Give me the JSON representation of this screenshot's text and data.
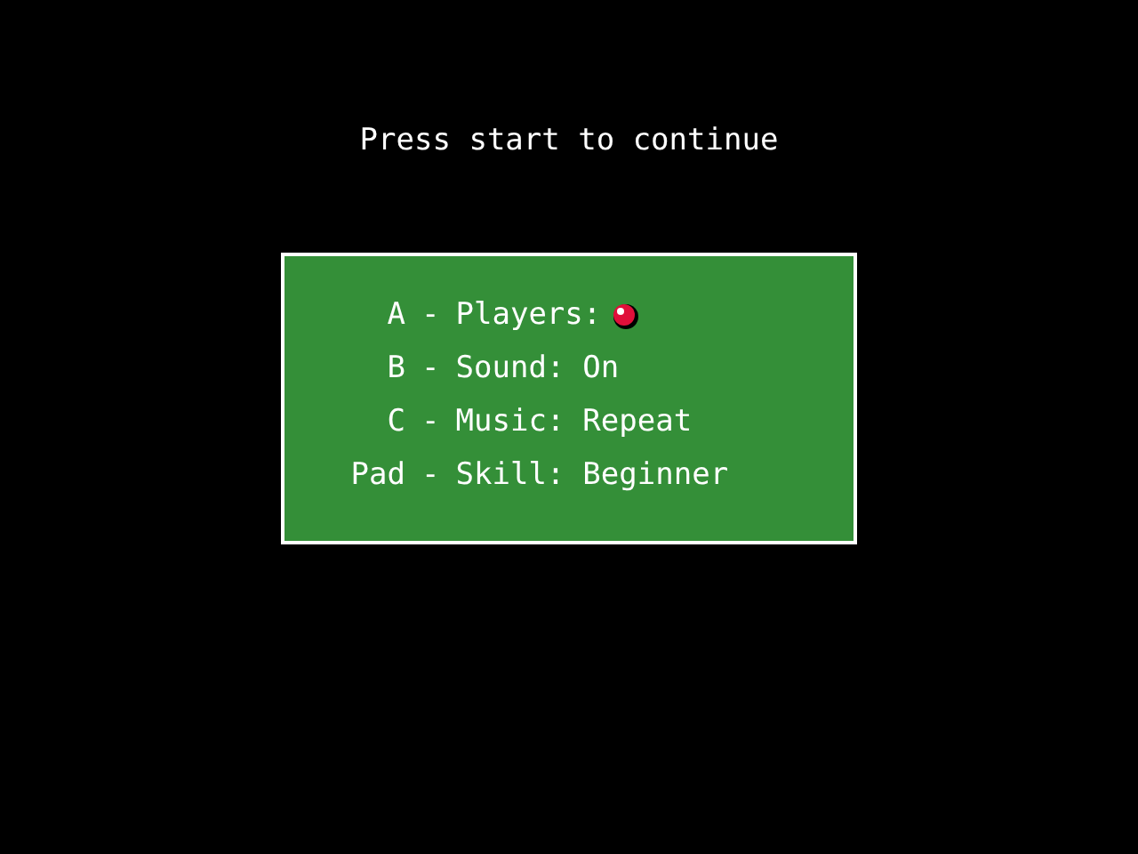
{
  "prompt": "Press start to continue",
  "options": [
    {
      "key": "A",
      "separator": "-",
      "label": "Players:",
      "kind": "icon"
    },
    {
      "key": "B",
      "separator": "-",
      "label": "Sound:",
      "value": "On",
      "kind": "text"
    },
    {
      "key": "C",
      "separator": "-",
      "label": "Music:",
      "value": "Repeat",
      "kind": "text"
    },
    {
      "key": "Pad",
      "separator": "-",
      "label": "Skill:",
      "value": "Beginner",
      "kind": "text"
    }
  ]
}
